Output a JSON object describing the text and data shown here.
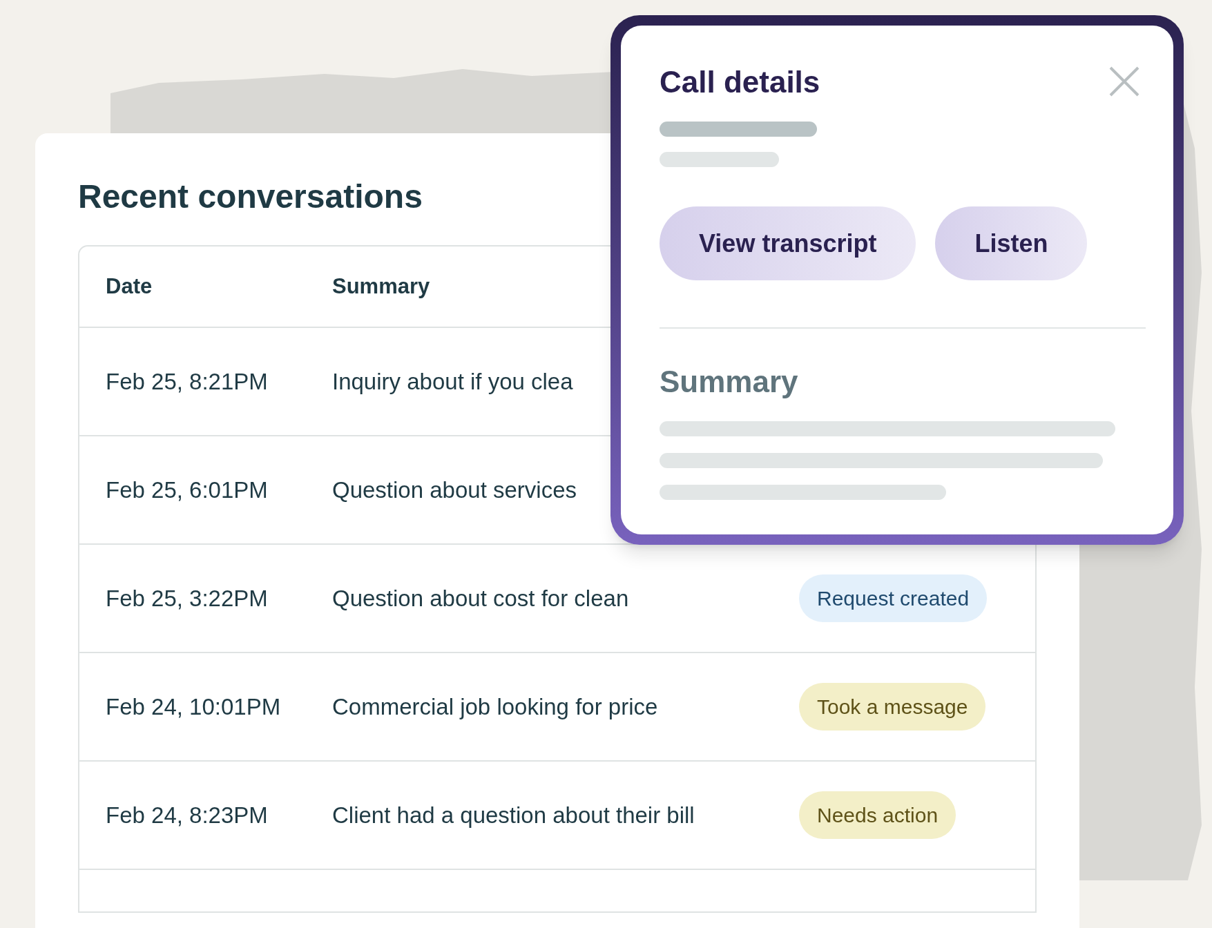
{
  "conversations": {
    "title": "Recent conversations",
    "columns": [
      "Date",
      "Summary"
    ],
    "rows": [
      {
        "date": "Feb 25, 8:21PM",
        "summary": "Inquiry about if you clea"
      },
      {
        "date": "Feb 25, 6:01PM",
        "summary": "Question about services"
      },
      {
        "date": "Feb 25, 3:22PM",
        "summary": "Question about cost for clean",
        "status": {
          "label": "Request created",
          "kind": "info"
        }
      },
      {
        "date": "Feb 24, 10:01PM",
        "summary": "Commercial job looking for price",
        "status": {
          "label": "Took a message",
          "kind": "warning"
        }
      },
      {
        "date": "Feb 24, 8:23PM",
        "summary": "Client had a question about their bill",
        "status": {
          "label": "Needs action",
          "kind": "warning"
        }
      }
    ]
  },
  "call_details": {
    "title": "Call details",
    "buttons": [
      "View transcript",
      "Listen"
    ],
    "summary_heading": "Summary"
  }
}
